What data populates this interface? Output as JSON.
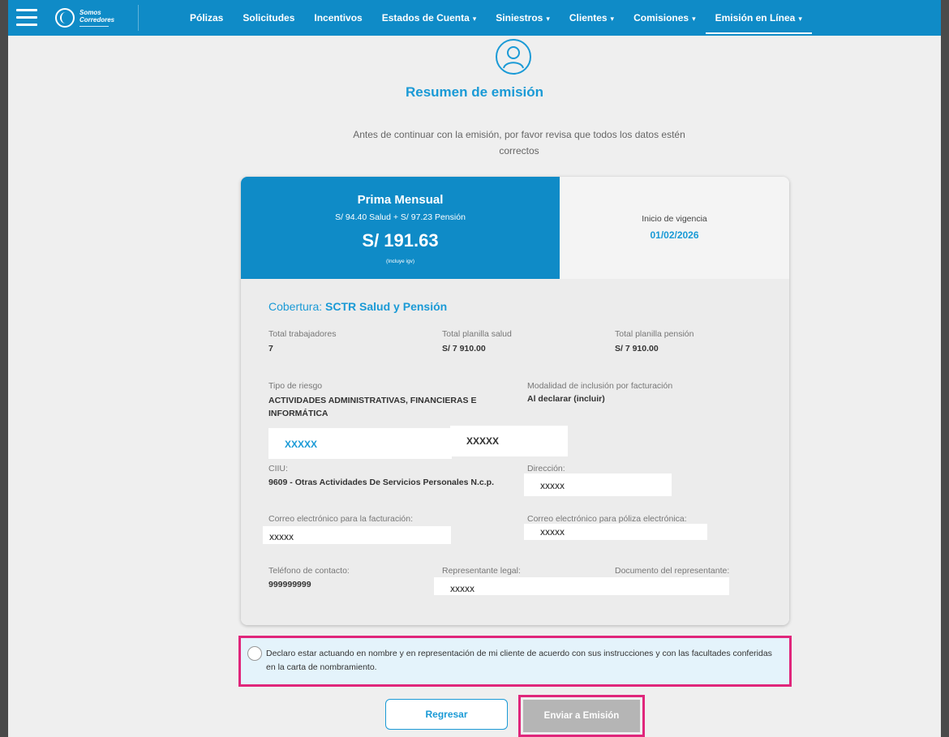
{
  "header": {
    "logo_line1": "Somos",
    "logo_line2": "Corredores",
    "nav": [
      {
        "label": "Pólizas",
        "caret": ""
      },
      {
        "label": "Solicitudes",
        "caret": ""
      },
      {
        "label": "Incentivos",
        "caret": ""
      },
      {
        "label": "Estados de Cuenta",
        "caret": "▾"
      },
      {
        "label": "Siniestros",
        "caret": "▾"
      },
      {
        "label": "Clientes",
        "caret": "▾"
      },
      {
        "label": "Comisiones",
        "caret": "▾"
      },
      {
        "label": "Emisión en Línea",
        "caret": "▾"
      }
    ]
  },
  "page": {
    "title": "Resumen de emisión",
    "subtitle": "Antes de continuar con la emisión, por favor revisa que todos los datos estén correctos"
  },
  "summary": {
    "prima_title": "Prima Mensual",
    "prima_breakdown": "S/ 94.40 Salud + S/ 97.23 Pensión",
    "prima_total": "S/ 191.63",
    "prima_note": "(Incluye igv)",
    "vigencia_label": "Inicio de vigencia",
    "vigencia_value": "01/02/2026"
  },
  "coverage": {
    "prefix": "Cobertura:",
    "name": "SCTR Salud y Pensión",
    "total_trabajadores_label": "Total trabajadores",
    "total_trabajadores_value": "7",
    "planilla_salud_label": "Total planilla salud",
    "planilla_salud_value": "S/ 7 910.00",
    "planilla_pension_label": "Total planilla pensión",
    "planilla_pension_value": "S/ 7 910.00",
    "tipo_riesgo_label": "Tipo de riesgo",
    "tipo_riesgo_value": "ACTIVIDADES ADMINISTRATIVAS, FINANCIERAS E INFORMÁTICA",
    "modalidad_label": "Modalidad de inclusión por facturación",
    "modalidad_value": "Al declarar (incluir)",
    "masked_1": "XXXXX",
    "masked_2": "XXXXX",
    "ciiu_label": "CIIU:",
    "ciiu_value": "9609 - Otras Actividades De Servicios Personales N.c.p.",
    "direccion_label": "Dirección:",
    "direccion_value": "XXXXX",
    "correo_fact_label": "Correo electrónico para la facturación:",
    "correo_fact_value": "XXXXX",
    "correo_poliza_label": "Correo electrónico para póliza electrónica:",
    "correo_poliza_value": "XXXXX",
    "telefono_label": "Teléfono de contacto:",
    "telefono_value": "999999999",
    "representante_label": "Representante legal:",
    "representante_value": "XXXXX",
    "documento_label": "Documento del representante:"
  },
  "declaration": {
    "text": "Declaro estar actuando en nombre y en representación de mi cliente de acuerdo con sus instrucciones y con las facultades conferidas en la carta de nombramiento."
  },
  "actions": {
    "back": "Regresar",
    "send": "Enviar a Emisión"
  }
}
